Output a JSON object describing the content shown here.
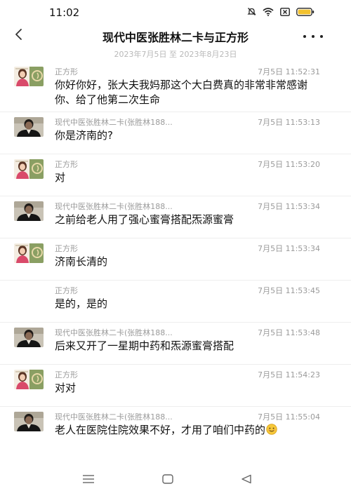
{
  "status_bar": {
    "time": "11:02"
  },
  "header": {
    "title": "现代中医张胜林二卡与正方形"
  },
  "date_range": "2023年7月5日 至 2023年8月23日",
  "messages": [
    {
      "sender": "正方形",
      "time": "7月5日 11:52:31",
      "content": "你好你好，张大夫我妈那这个大白费真的非常非常感谢你、给了他第二次生命",
      "avatar": "avatar-square"
    },
    {
      "sender": "现代中医张胜林二卡(张胜林188...",
      "time": "7月5日 11:53:13",
      "content": "你是济南的?",
      "avatar": "avatar-doctor"
    },
    {
      "sender": "正方形",
      "time": "7月5日 11:53:20",
      "content": "对",
      "avatar": "avatar-square"
    },
    {
      "sender": "现代中医张胜林二卡(张胜林188...",
      "time": "7月5日 11:53:34",
      "content": "之前给老人用了强心蜜膏搭配炁源蜜膏",
      "avatar": "avatar-doctor"
    },
    {
      "sender": "正方形",
      "time": "7月5日 11:53:34",
      "content": "济南长清的",
      "avatar": "avatar-square"
    },
    {
      "sender": "正方形",
      "time": "7月5日 11:53:45",
      "content": "是的，是的",
      "avatar": ""
    },
    {
      "sender": "现代中医张胜林二卡(张胜林188...",
      "time": "7月5日 11:53:48",
      "content": "后来又开了一星期中药和炁源蜜膏搭配",
      "avatar": "avatar-doctor"
    },
    {
      "sender": "正方形",
      "time": "7月5日 11:54:23",
      "content": "对对",
      "avatar": "avatar-square"
    },
    {
      "sender": "现代中医张胜林二卡(张胜林188...",
      "time": "7月5日 11:55:04",
      "content": "老人在医院住院效果不好，才用了咱们中药的",
      "avatar": "avatar-doctor",
      "emoji": "smile-emoji"
    }
  ],
  "colors": {
    "meta_text": "#9a9a9a",
    "divider": "#eeeeee",
    "date_text": "#b8b8b8"
  }
}
